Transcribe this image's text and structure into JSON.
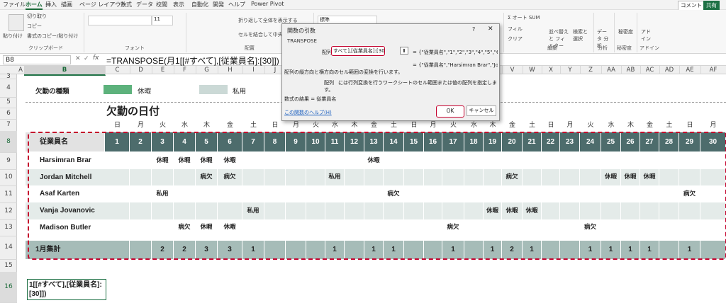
{
  "menu": [
    "ファイル",
    "ホーム",
    "挿入",
    "描画",
    "ページ レイアウト",
    "数式",
    "データ",
    "校閲",
    "表示",
    "自動化",
    "開発",
    "ヘルプ",
    "Power Pivot"
  ],
  "topright": {
    "comment": "コメント",
    "share": "共有"
  },
  "ribbon": {
    "cut": "切り取り",
    "copy": "コピー",
    "format_painter": "書式のコピー/貼り付け",
    "paste": "貼り付け",
    "clipboard": "クリップボード",
    "font": "フォント",
    "font_size": "11",
    "wrap": "折り返して全体を表示する",
    "merge": "セルを結合して中央揃え",
    "alignment": "配置",
    "number_format": "標準",
    "autosum": "オート SUM",
    "fill": "フィル",
    "clear": "クリア",
    "sort_filter": "並べ替えと フィルター",
    "find_select": "検索と 選択",
    "editing": "編集",
    "analyze_data": "データ 分析",
    "analysis": "分析",
    "sensitivity": "秘密度",
    "addins_btn": "アド イン",
    "addins": "アドイン"
  },
  "namebox": "B8",
  "formula": "=TRANSPOSE(月1[[#すべて],[従業員名]:[30]])",
  "columns": [
    "A",
    "B",
    "C",
    "D",
    "E",
    "F",
    "G",
    "H",
    "I",
    "J",
    "K",
    "L",
    "M",
    "N",
    "O",
    "P",
    "Q",
    "R",
    "S",
    "T",
    "U",
    "V",
    "W",
    "X",
    "Y",
    "Z",
    "AA",
    "AB",
    "AC",
    "AD",
    "AE",
    "AF"
  ],
  "rows": [
    "3",
    "4",
    "5",
    "6",
    "7",
    "8",
    "9",
    "10",
    "11",
    "12",
    "13",
    "14",
    "15",
    "16"
  ],
  "legend": {
    "label": "欠勤の種類",
    "item1": "休暇",
    "item2": "私用"
  },
  "title": "欠勤の日付",
  "weekdays": [
    "日",
    "月",
    "火",
    "水",
    "木",
    "金",
    "土",
    "日",
    "月",
    "火",
    "水",
    "木",
    "金",
    "土",
    "日",
    "月",
    "火",
    "水",
    "木",
    "金",
    "土",
    "日",
    "月",
    "火",
    "水",
    "木",
    "金",
    "土",
    "日",
    "月"
  ],
  "table": {
    "header_label": "従業員名",
    "days": [
      "1",
      "2",
      "3",
      "4",
      "5",
      "6",
      "7",
      "8",
      "9",
      "10",
      "11",
      "12",
      "13",
      "14",
      "15",
      "16",
      "17",
      "18",
      "19",
      "20",
      "21",
      "22",
      "23",
      "24",
      "25",
      "26",
      "27",
      "28",
      "29",
      "30"
    ],
    "employees": [
      {
        "name": "Harsimran Brar",
        "marks": {
          "3": "休暇",
          "4": "休暇",
          "5": "休暇",
          "6": "休暇",
          "13": "休暇"
        }
      },
      {
        "name": "Jordan Mitchell",
        "marks": {
          "5": "病欠",
          "6": "病欠",
          "11": "私用",
          "20": "病欠",
          "25": "休暇",
          "26": "休暇",
          "27": "休暇"
        }
      },
      {
        "name": "Asaf Karten",
        "marks": {
          "3": "私用",
          "14": "病欠",
          "29": "病欠"
        }
      },
      {
        "name": "Vanja Jovanovic",
        "marks": {
          "7": "私用",
          "19": "休暇",
          "20": "休暇",
          "21": "休暇"
        }
      },
      {
        "name": "Madison Butler",
        "marks": {
          "4": "病欠",
          "5": "休暇",
          "6": "休暇",
          "17": "病欠",
          "24": "病欠"
        }
      }
    ],
    "total_label": "1月集計",
    "totals": {
      "3": "2",
      "4": "2",
      "5": "3",
      "6": "3",
      "7": "1",
      "11": "1",
      "13": "1",
      "14": "1",
      "17": "1",
      "19": "1",
      "20": "2",
      "21": "1",
      "24": "1",
      "25": "1",
      "26": "1",
      "27": "1",
      "29": "1"
    }
  },
  "b16": "1[[#すべて],[従業員名]:[30]])",
  "dialog": {
    "title": "関数の引数",
    "help": "?",
    "close": "✕",
    "function": "TRANSPOSE",
    "arg_label": "配列",
    "arg_value": "すべて],[従業員名]:[30]]",
    "ref_button": "⬆",
    "arg_result": "= {\"従業員名\",\"1\",\"2\",\"3\",\"4\",\"5\",\"6\",...",
    "result_preview": "= {\"従業員名\",\"Harsimran Brar\",\"Jo...",
    "desc": "配列の縦方向と横方向のセル範囲の変換を行います。",
    "arg_desc_name": "配列",
    "arg_desc": "には行列変換を行うワークシートのセル範囲または値の配列を指定します。",
    "result_label": "数式の結果 =",
    "result_value": "従業員名",
    "help_link": "この関数のヘルプ(H)",
    "ok": "OK",
    "cancel": "キャンセル"
  },
  "colors": {
    "header_teal": "#4d6c6c",
    "band": "#e4ebe9",
    "total_band": "#a6bcb8",
    "vacation": "#5db27c",
    "personal": "#cbd9d6",
    "highlight_red": "#c4002c"
  }
}
